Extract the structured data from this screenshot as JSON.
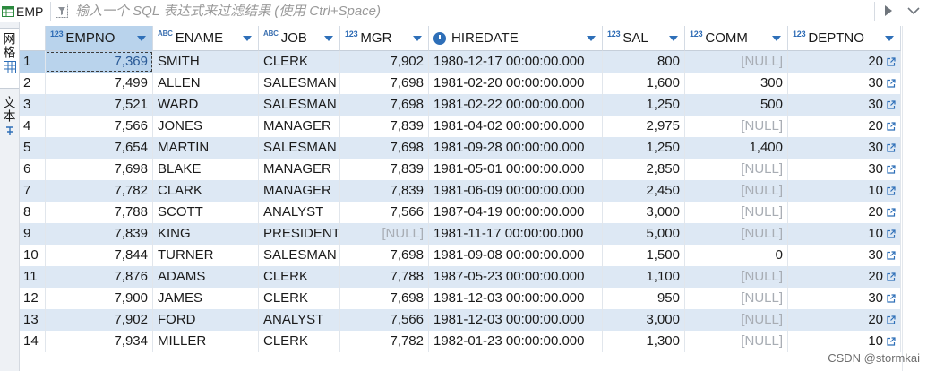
{
  "filter_bar": {
    "table_name": "EMP",
    "filter_placeholder": "输入一个 SQL 表达式来过滤结果 (使用 Ctrl+Space)"
  },
  "side_panel": {
    "tabs": [
      {
        "label": "网格",
        "icon": "grid-icon",
        "active": true
      },
      {
        "label": "文本",
        "icon": "text-icon",
        "active": false
      }
    ]
  },
  "grid": {
    "columns": [
      {
        "name": "EMPNO",
        "type_icon": "123",
        "align": "right"
      },
      {
        "name": "ENAME",
        "type_icon": "ABC",
        "align": "left"
      },
      {
        "name": "JOB",
        "type_icon": "ABC",
        "align": "left"
      },
      {
        "name": "MGR",
        "type_icon": "123",
        "align": "right"
      },
      {
        "name": "HIREDATE",
        "type_icon": "clock",
        "align": "left"
      },
      {
        "name": "SAL",
        "type_icon": "123",
        "align": "right"
      },
      {
        "name": "COMM",
        "type_icon": "123",
        "align": "right"
      },
      {
        "name": "DEPTNO",
        "type_icon": "123",
        "align": "right"
      }
    ],
    "null_text": "[NULL]",
    "rows": [
      {
        "n": "1",
        "cells": [
          "7,369",
          "SMITH",
          "CLERK",
          "7,902",
          "1980-12-17 00:00:00.000",
          "800",
          "[NULL]",
          "20"
        ]
      },
      {
        "n": "2",
        "cells": [
          "7,499",
          "ALLEN",
          "SALESMAN",
          "7,698",
          "1981-02-20 00:00:00.000",
          "1,600",
          "300",
          "30"
        ]
      },
      {
        "n": "3",
        "cells": [
          "7,521",
          "WARD",
          "SALESMAN",
          "7,698",
          "1981-02-22 00:00:00.000",
          "1,250",
          "500",
          "30"
        ]
      },
      {
        "n": "4",
        "cells": [
          "7,566",
          "JONES",
          "MANAGER",
          "7,839",
          "1981-04-02 00:00:00.000",
          "2,975",
          "[NULL]",
          "20"
        ]
      },
      {
        "n": "5",
        "cells": [
          "7,654",
          "MARTIN",
          "SALESMAN",
          "7,698",
          "1981-09-28 00:00:00.000",
          "1,250",
          "1,400",
          "30"
        ]
      },
      {
        "n": "6",
        "cells": [
          "7,698",
          "BLAKE",
          "MANAGER",
          "7,839",
          "1981-05-01 00:00:00.000",
          "2,850",
          "[NULL]",
          "30"
        ]
      },
      {
        "n": "7",
        "cells": [
          "7,782",
          "CLARK",
          "MANAGER",
          "7,839",
          "1981-06-09 00:00:00.000",
          "2,450",
          "[NULL]",
          "10"
        ]
      },
      {
        "n": "8",
        "cells": [
          "7,788",
          "SCOTT",
          "ANALYST",
          "7,566",
          "1987-04-19 00:00:00.000",
          "3,000",
          "[NULL]",
          "20"
        ]
      },
      {
        "n": "9",
        "cells": [
          "7,839",
          "KING",
          "PRESIDENT",
          "[NULL]",
          "1981-11-17 00:00:00.000",
          "5,000",
          "[NULL]",
          "10"
        ]
      },
      {
        "n": "10",
        "cells": [
          "7,844",
          "TURNER",
          "SALESMAN",
          "7,698",
          "1981-09-08 00:00:00.000",
          "1,500",
          "0",
          "30"
        ]
      },
      {
        "n": "11",
        "cells": [
          "7,876",
          "ADAMS",
          "CLERK",
          "7,788",
          "1987-05-23 00:00:00.000",
          "1,100",
          "[NULL]",
          "20"
        ]
      },
      {
        "n": "12",
        "cells": [
          "7,900",
          "JAMES",
          "CLERK",
          "7,698",
          "1981-12-03 00:00:00.000",
          "950",
          "[NULL]",
          "30"
        ]
      },
      {
        "n": "13",
        "cells": [
          "7,902",
          "FORD",
          "ANALYST",
          "7,566",
          "1981-12-03 00:00:00.000",
          "3,000",
          "[NULL]",
          "20"
        ]
      },
      {
        "n": "14",
        "cells": [
          "7,934",
          "MILLER",
          "CLERK",
          "7,782",
          "1982-01-23 00:00:00.000",
          "1,300",
          "[NULL]",
          "10"
        ]
      }
    ]
  },
  "watermark": "CSDN @stormkai",
  "colors": {
    "accent": "#2e6fb8",
    "row_alt": "#dde8f4",
    "selection": "#b9d3ec",
    "null_text": "#a8adb4"
  }
}
